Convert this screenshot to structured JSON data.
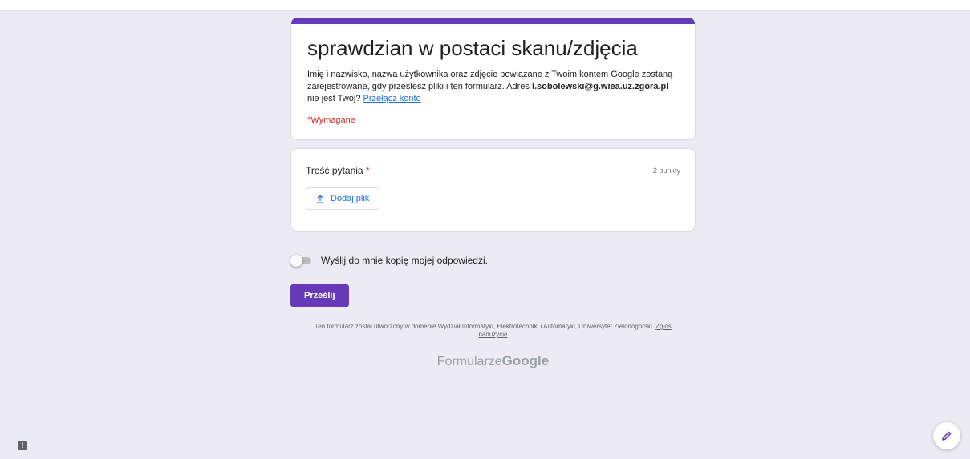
{
  "form": {
    "title": "sprawdzian w postaci skanu/zdjęcia",
    "desc_part1": "Imię i nazwisko, nazwa użytkownika oraz zdjęcie powiązane z Twoim kontem Google zostaną zarejestrowane, gdy prześlesz pliki i ten formularz. Adres ",
    "email": "l.sobolewski@g.wiea.uz.zgora.pl",
    "desc_part2": " nie jest Twój? ",
    "switch_account": "Przełącz konto",
    "required_note": "*Wymagane",
    "accent_color": "#673ab7"
  },
  "question": {
    "title": "Treść pytania",
    "required_mark": " *",
    "points": "2 punkty",
    "upload_label": "Dodaj plik",
    "upload_icon": "upload-icon"
  },
  "copy_toggle": {
    "label": "Wyślij do mnie kopię mojej odpowiedzi.",
    "checked": false
  },
  "submit_label": "Prześlij",
  "footer": {
    "note": "Ten formularz został utworzony w domenie Wydział Informatyki, Elektrotechniki i Automatyki, Uniwersytet Zielonogórski. ",
    "abuse_link": "Zgłoś nadużycie",
    "brand_prefix": "Formularze",
    "brand_google": "Google"
  },
  "icons": {
    "feedback": "feedback-icon",
    "edit": "pencil-icon"
  }
}
